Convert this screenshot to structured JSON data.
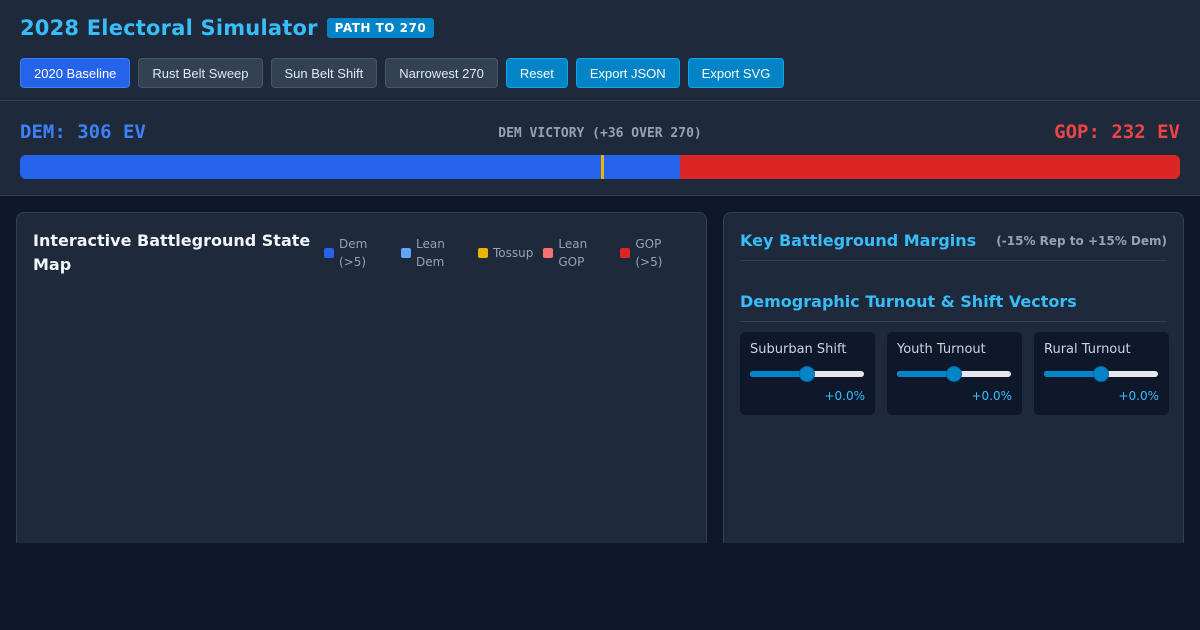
{
  "header": {
    "title": "2028 Electoral Simulator",
    "badge": "PATH TO 270"
  },
  "toolbar": {
    "buttons": [
      {
        "label": "2020 Baseline",
        "style": "primary"
      },
      {
        "label": "Rust Belt Sweep",
        "style": "default"
      },
      {
        "label": "Sun Belt Shift",
        "style": "default"
      },
      {
        "label": "Narrowest 270",
        "style": "default"
      },
      {
        "label": "Reset",
        "style": "accent"
      },
      {
        "label": "Export JSON",
        "style": "accent"
      },
      {
        "label": "Export SVG",
        "style": "accent"
      }
    ]
  },
  "tally": {
    "dem_label": "DEM: 306 EV",
    "gop_label": "GOP: 232 EV",
    "status": "DEM VICTORY (+36 OVER 270)",
    "dem_ev": 306,
    "gop_ev": 232,
    "total_ev": 538,
    "threshold_ev": 270,
    "colors": {
      "dem": "#2563eb",
      "gop": "#dc2626",
      "threshold": "#eab308"
    }
  },
  "map_panel": {
    "title": "Interactive Battleground State Map",
    "legend": [
      {
        "label": "Dem (>5)",
        "color": "#2563eb"
      },
      {
        "label": "Lean Dem",
        "color": "#60a5fa"
      },
      {
        "label": "Tossup",
        "color": "#eab308"
      },
      {
        "label": "Lean GOP",
        "color": "#f87171"
      },
      {
        "label": "GOP (>5)",
        "color": "#dc2626"
      }
    ]
  },
  "margins_panel": {
    "title": "Key Battleground Margins",
    "range_note": "(-15% Rep to +15% Dem)"
  },
  "turnout_panel": {
    "title": "Demographic Turnout & Shift Vectors",
    "sliders": [
      {
        "label": "Suburban Shift",
        "value_text": "+0.0%",
        "position": 0.5
      },
      {
        "label": "Youth Turnout",
        "value_text": "+0.0%",
        "position": 0.5
      },
      {
        "label": "Rural Turnout",
        "value_text": "+0.0%",
        "position": 0.5
      }
    ]
  }
}
